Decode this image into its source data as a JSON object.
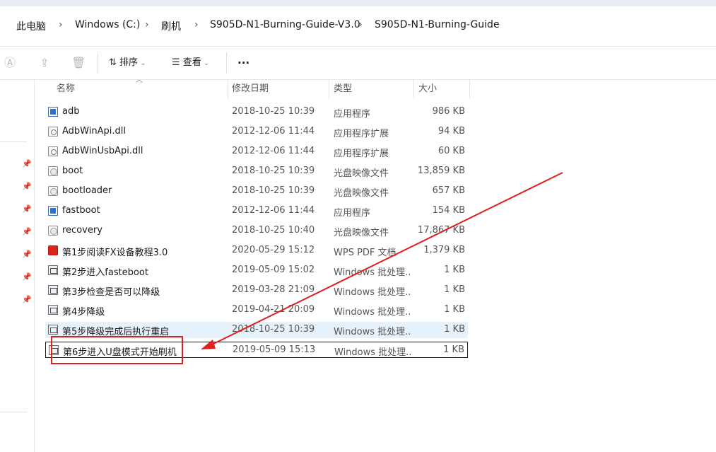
{
  "breadcrumbs": [
    "此电脑",
    "Windows (C:)",
    "刷机",
    "S905D-N1-Burning-Guide-V3.0",
    "S905D-N1-Burning-Guide"
  ],
  "toolbar": {
    "sort_label": "排序",
    "view_label": "查看",
    "more_label": "···"
  },
  "columns": {
    "name": "名称",
    "date": "修改日期",
    "type": "类型",
    "size": "大小"
  },
  "files": [
    {
      "name": "adb",
      "date": "2018-10-25 10:39",
      "type": "应用程序",
      "size": "986 KB",
      "icon": "application-icon"
    },
    {
      "name": "AdbWinApi.dll",
      "date": "2012-12-06 11:44",
      "type": "应用程序扩展",
      "size": "94 KB",
      "icon": "dll-icon"
    },
    {
      "name": "AdbWinUsbApi.dll",
      "date": "2012-12-06 11:44",
      "type": "应用程序扩展",
      "size": "60 KB",
      "icon": "dll-icon"
    },
    {
      "name": "boot",
      "date": "2018-10-25 10:39",
      "type": "光盘映像文件",
      "size": "13,859 KB",
      "icon": "disc-image-icon"
    },
    {
      "name": "bootloader",
      "date": "2018-10-25 10:39",
      "type": "光盘映像文件",
      "size": "657 KB",
      "icon": "disc-image-icon"
    },
    {
      "name": "fastboot",
      "date": "2012-12-06 11:44",
      "type": "应用程序",
      "size": "154 KB",
      "icon": "application-icon"
    },
    {
      "name": "recovery",
      "date": "2018-10-25 10:40",
      "type": "光盘映像文件",
      "size": "17,867 KB",
      "icon": "disc-image-icon"
    },
    {
      "name": "第1步阅读FX设备教程3.0",
      "date": "2020-05-29 15:12",
      "type": "WPS PDF 文档",
      "size": "1,379 KB",
      "icon": "pdf-icon"
    },
    {
      "name": "第2步进入fasteboot",
      "date": "2019-05-09 15:02",
      "type": "Windows 批处理...",
      "size": "1 KB",
      "icon": "batch-file-icon"
    },
    {
      "name": "第3步检查是否可以降级",
      "date": "2019-03-28 21:09",
      "type": "Windows 批处理...",
      "size": "1 KB",
      "icon": "batch-file-icon"
    },
    {
      "name": "第4步降级",
      "date": "2019-04-21 20:09",
      "type": "Windows 批处理...",
      "size": "1 KB",
      "icon": "batch-file-icon"
    },
    {
      "name": "第5步降级完成后执行重启",
      "date": "2018-10-25 10:39",
      "type": "Windows 批处理...",
      "size": "1 KB",
      "icon": "batch-file-icon"
    },
    {
      "name": "第6步进入U盘模式开始刷机",
      "date": "2019-05-09 15:13",
      "type": "Windows 批处理...",
      "size": "1 KB",
      "icon": "batch-file-icon"
    }
  ],
  "annotation": {
    "color": "#e01f1f"
  }
}
